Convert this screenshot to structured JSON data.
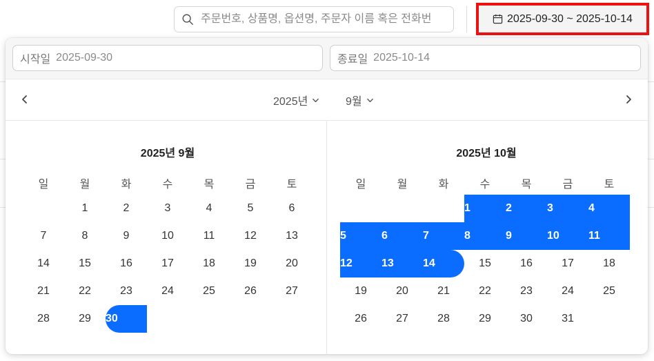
{
  "search": {
    "placeholder": "주문번호, 상품명, 옵션명, 주문자 이름 혹은 전화번"
  },
  "date_range_button": {
    "label": "2025-09-30 ~ 2025-10-14",
    "icon": "calendar-icon",
    "highlight_color": "#ee1111"
  },
  "picker": {
    "start_field": {
      "label": "시작일",
      "value": "2025-09-30"
    },
    "end_field": {
      "label": "종료일",
      "value": "2025-10-14"
    },
    "year_select": "2025년",
    "month_select": "9월",
    "weekdays": [
      "일",
      "월",
      "화",
      "수",
      "목",
      "금",
      "토"
    ],
    "accent_color": "#0b6dff",
    "months": [
      {
        "title": "2025년 9월",
        "first_weekday": 1,
        "days": [
          "1",
          "2",
          "3",
          "4",
          "5",
          "6",
          "7",
          "8",
          "9",
          "10",
          "11",
          "12",
          "13",
          "14",
          "15",
          "16",
          "17",
          "18",
          "19",
          "20",
          "21",
          "22",
          "23",
          "24",
          "25",
          "26",
          "27",
          "28",
          "29",
          "30"
        ],
        "selected": [
          "30"
        ]
      },
      {
        "title": "2025년 10월",
        "first_weekday": 3,
        "days": [
          "1",
          "2",
          "3",
          "4",
          "5",
          "6",
          "7",
          "8",
          "9",
          "10",
          "11",
          "12",
          "13",
          "14",
          "15",
          "16",
          "17",
          "18",
          "19",
          "20",
          "21",
          "22",
          "23",
          "24",
          "25",
          "26",
          "27",
          "28",
          "29",
          "30",
          "31"
        ],
        "selected": [
          "1",
          "2",
          "3",
          "4",
          "5",
          "6",
          "7",
          "8",
          "9",
          "10",
          "11",
          "12",
          "13",
          "14"
        ]
      }
    ]
  }
}
